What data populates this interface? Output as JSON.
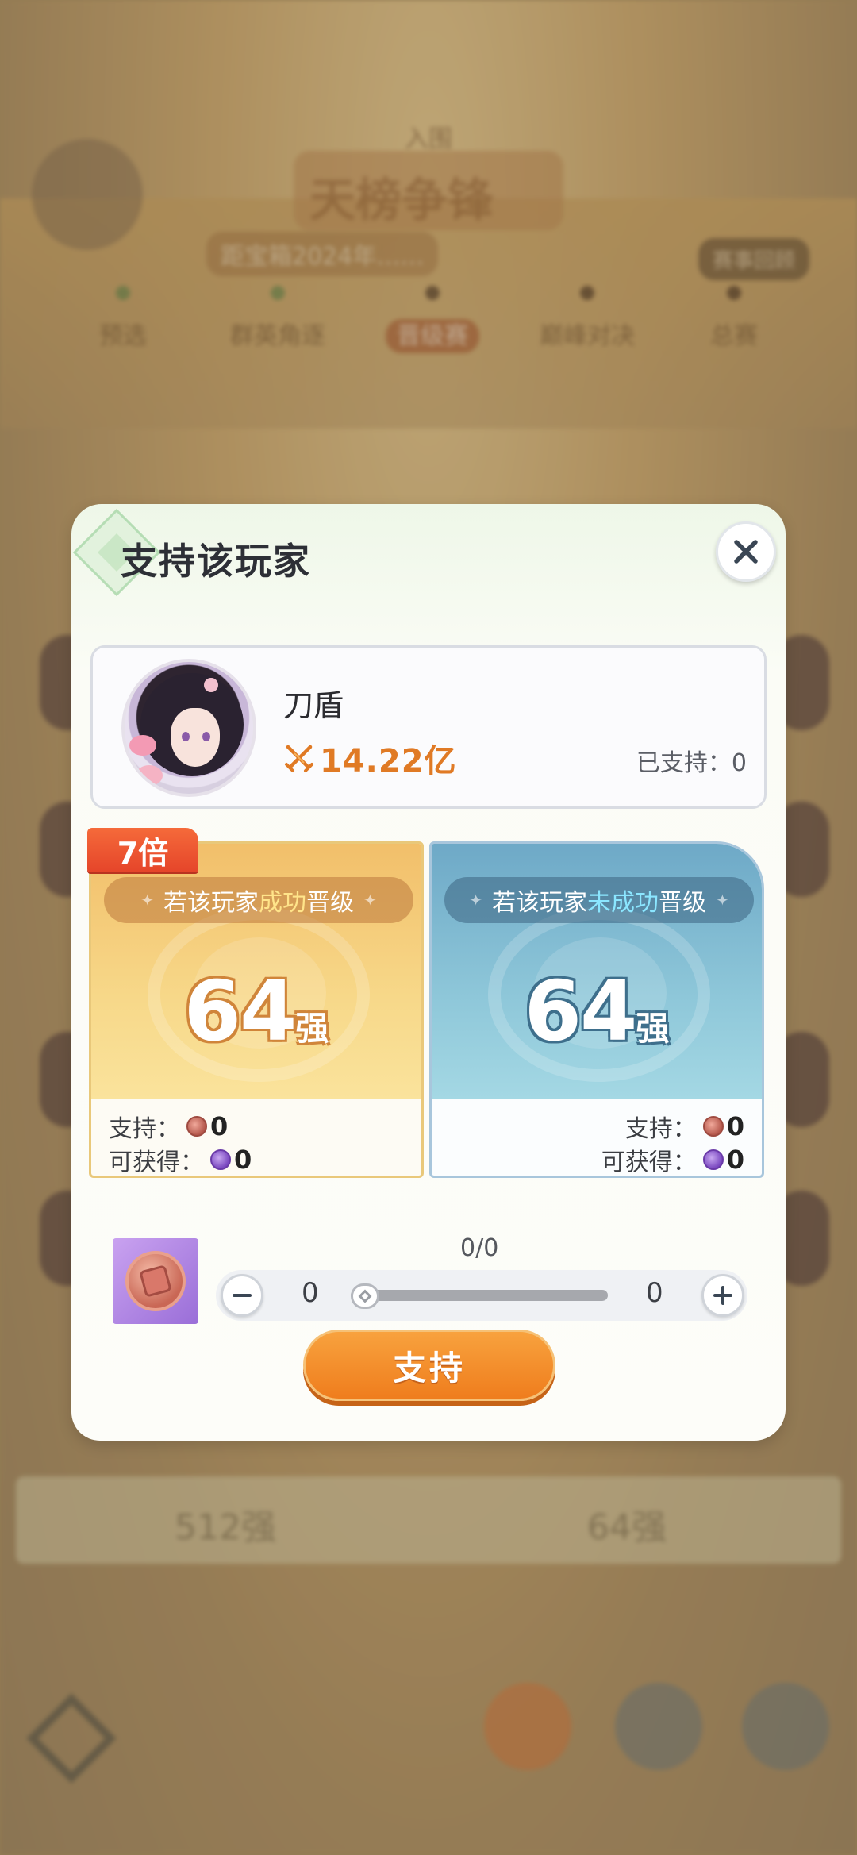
{
  "background": {
    "event_name": "天榜争锋",
    "event_top": "入围",
    "time_text": "距宝箱2024年……",
    "right_tag": "赛事回顾",
    "stages": [
      "预选",
      "群英角逐",
      "晋级赛",
      "巅峰对决",
      "总赛"
    ],
    "bottom_left": "512强",
    "bottom_right": "64强",
    "nav": [
      "",
      "",
      ""
    ]
  },
  "modal": {
    "title": "支持该玩家",
    "player": {
      "name": "刀盾",
      "power": "14.22亿",
      "supported_label": "已支持：",
      "supported_value": "0"
    },
    "multiplier": "7倍",
    "success": {
      "pill_pre": "若该玩家",
      "pill_hl": "成功",
      "pill_post": "晋级",
      "rank_number": "64",
      "rank_suffix": "强",
      "support_label": "支持：",
      "support_value": "0",
      "gain_label": "可获得：",
      "gain_value": "0"
    },
    "fail": {
      "pill_pre": "若该玩家",
      "pill_hl": "未成功",
      "pill_post": "晋级",
      "rank_number": "64",
      "rank_suffix": "强",
      "support_label": "支持：",
      "support_value": "0",
      "gain_label": "可获得：",
      "gain_value": "0"
    },
    "slider": {
      "count": "0/0",
      "min_value": "0",
      "max_value": "0",
      "fraction": 0
    },
    "support_button": "支持"
  },
  "colors": {
    "accent_orange": "#ef7d1d",
    "multiplier_red": "#e5452a",
    "success_gold": "#f2bf6a",
    "fail_blue": "#6ea9c7"
  }
}
